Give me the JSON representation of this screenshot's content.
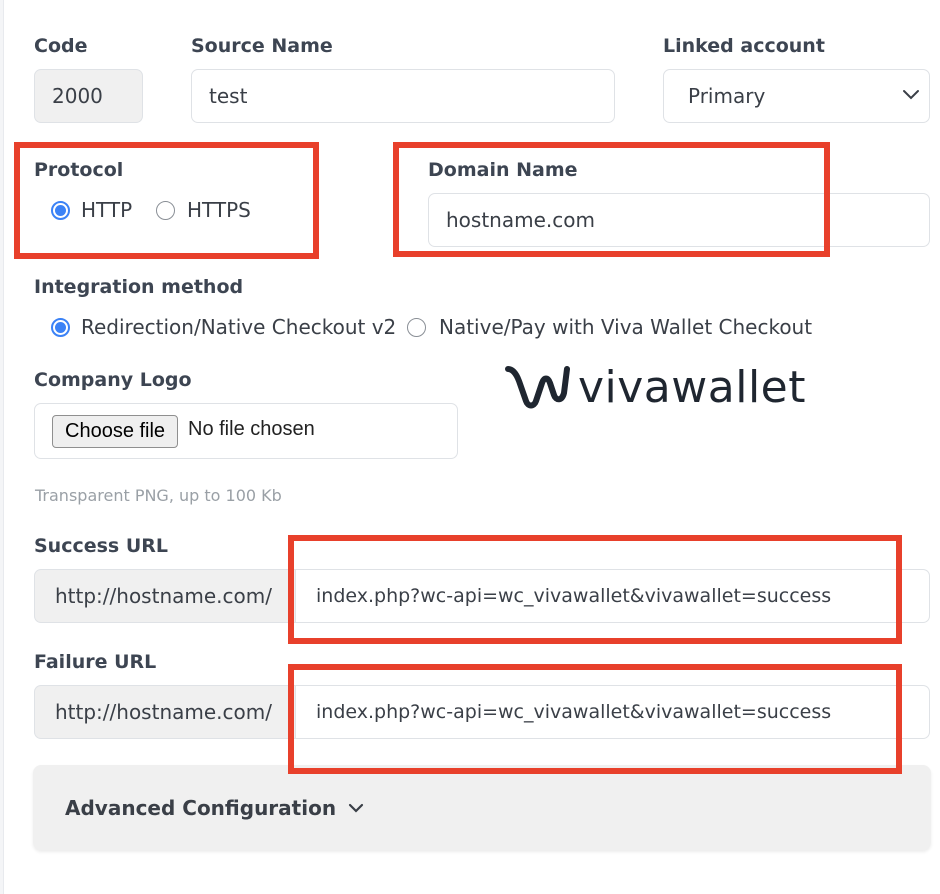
{
  "form": {
    "code": {
      "label": "Code",
      "value": "2000"
    },
    "source_name": {
      "label": "Source Name",
      "value": "test"
    },
    "linked_account": {
      "label": "Linked account",
      "value": "Primary"
    },
    "protocol": {
      "label": "Protocol",
      "options": [
        {
          "label": "HTTP",
          "checked": true
        },
        {
          "label": "HTTPS",
          "checked": false
        }
      ]
    },
    "domain_name": {
      "label": "Domain Name",
      "value": "hostname.com"
    },
    "integration_method": {
      "label": "Integration method",
      "options": [
        {
          "label": "Redirection/Native Checkout v2",
          "checked": true
        },
        {
          "label": "Native/Pay with Viva Wallet Checkout",
          "checked": false
        }
      ]
    },
    "company_logo": {
      "label": "Company Logo",
      "button_label": "Choose file",
      "status": "No file chosen",
      "hint": "Transparent PNG, up to 100 Kb"
    },
    "success_url": {
      "label": "Success URL",
      "prefix": "http://hostname.com/",
      "value": "index.php?wc-api=wc_vivawallet&vivawallet=success"
    },
    "failure_url": {
      "label": "Failure URL",
      "prefix": "http://hostname.com/",
      "value": "index.php?wc-api=wc_vivawallet&vivawallet=success"
    },
    "advanced": {
      "label": "Advanced Configuration"
    }
  },
  "brand": {
    "logo_text": "vivawallet",
    "logo_icon": "viva-wave-icon"
  },
  "colors": {
    "highlight": "#e8402b",
    "radio_accent": "#3b82f6",
    "label_text": "#3d4552"
  }
}
